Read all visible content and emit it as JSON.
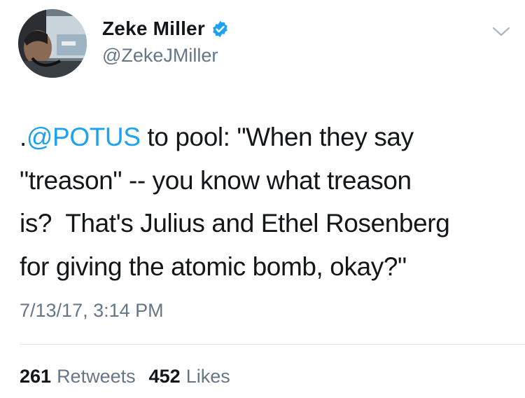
{
  "author": {
    "display_name": "Zeke Miller",
    "handle": "@ZekeJMiller",
    "verified": true,
    "avatar_icon": "profile-photo"
  },
  "menu": {
    "icon": "chevron-down-icon"
  },
  "tweet": {
    "lines": [
      {
        "prefix": ".",
        "mention": "@POTUS",
        "rest": " to pool: \"When they say"
      },
      {
        "text": "\"treason\" -- you know what treason"
      },
      {
        "text": "is?  That's Julius and Ethel Rosenberg"
      },
      {
        "text": "for giving the atomic bomb, okay?\""
      }
    ],
    "timestamp": "7/13/17, 3:14 PM"
  },
  "stats": {
    "retweets_count": "261",
    "retweets_label": "Retweets",
    "likes_count": "452",
    "likes_label": "Likes"
  },
  "colors": {
    "link": "#1da1f2",
    "secondary_text": "#657786",
    "verified_badge": "#1da1f2",
    "divider": "#e1e8ed"
  }
}
